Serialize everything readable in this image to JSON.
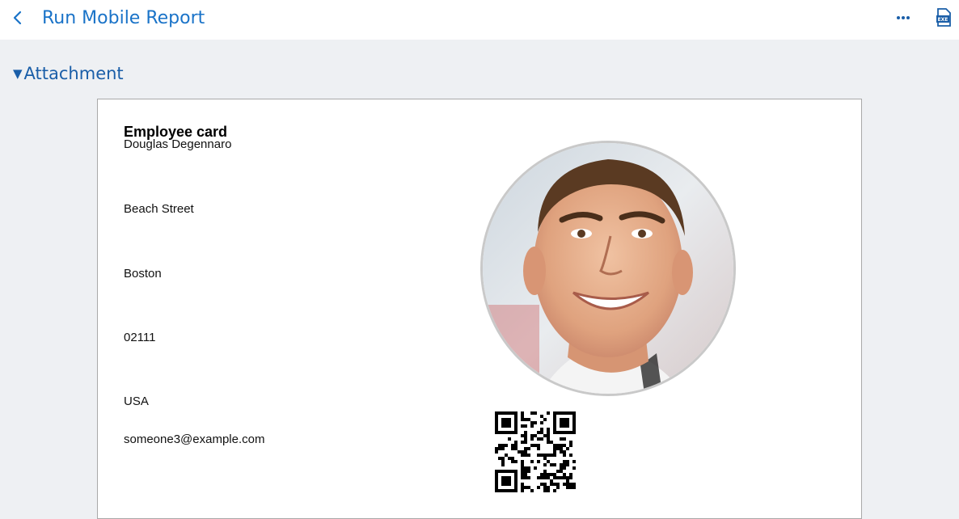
{
  "header": {
    "title": "Run Mobile Report",
    "back_icon": "chevron-left-icon",
    "more_icon": "ellipsis-icon",
    "export_icon": "excel-export-icon",
    "accent_color": "#1a73c8"
  },
  "section": {
    "toggle_symbol": "▼",
    "label": "Attachment"
  },
  "card": {
    "title": "Employee card",
    "name": "Douglas Degennaro",
    "street": "Beach Street",
    "city": "Boston",
    "zip": "02111",
    "country": "USA",
    "email": "someone3@example.com"
  }
}
